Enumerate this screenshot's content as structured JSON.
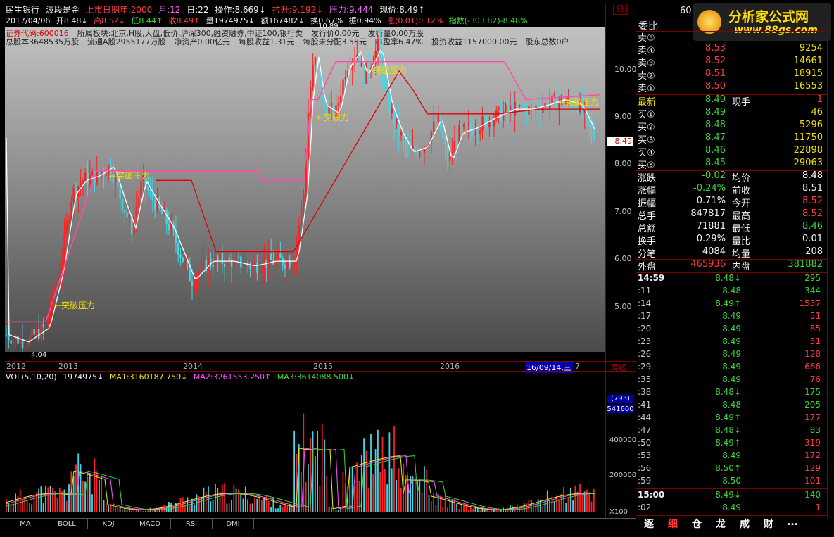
{
  "header": {
    "stock_name": "民生银行",
    "indicator": "波段是金",
    "listing_years": "上市日期年:2000",
    "month": "月:12",
    "day": "日:22",
    "operate": "操作:8.669↓",
    "pull_up": "拉升:9.192↓",
    "pressure": "压力:9.444",
    "current": "现价:8.49↑",
    "date": "2017/04/06",
    "open": "开8.48↓",
    "high": "高8.52↓",
    "low": "低8.44↑",
    "close": "收8.49↑",
    "vol": "量1974975↓",
    "amount": "额167482↓",
    "turnover": "换0.67%",
    "amplitude": "振0.94%",
    "change": "涨(0.01)0.12%",
    "index": "指数(-303.82)-8.48%"
  },
  "info": {
    "line1": [
      "证券代码:600016",
      "所属板块:北京,H股,大盘,低价,沪深300,融资融券,中证100,银行类",
      "发行价0.00元",
      "发行量0.00万股"
    ],
    "line2": [
      "总股本3648535万股",
      "流通A股2955177万股",
      "净资产0.00亿元",
      "每股收益1.31元",
      "每股未分配3.58元",
      "市盈率6.47%",
      "投资收益1157000.00元",
      "股东总数0户"
    ]
  },
  "annotations": {
    "break1": "←突破压力",
    "break2": "←突破压力",
    "break3": "←突破力",
    "break4": "←突破压力",
    "break5": "←突破压力",
    "low_label": "4.04",
    "high_label": "10.89"
  },
  "y_axis": [
    "10.00",
    "9.00",
    "8.00",
    "7.00",
    "6.00",
    "5.00"
  ],
  "price_tag": "8.49",
  "time_axis": [
    "2012",
    "2013",
    "2014",
    "2015",
    "2016"
  ],
  "time_cursor": "16/09/14,三",
  "time_cursor_tail": "7",
  "period_label": "周线",
  "top_right_box": "日",
  "vol_header": {
    "name": "VOL(5,10,20)",
    "vol": "1974975↓",
    "ma1": "MA1:3160187.750↓",
    "ma2": "MA2:3261553.250↑",
    "ma3": "MA3:3614088.500↓"
  },
  "vol_y_axis": [
    "400000",
    "200000"
  ],
  "vol_box1": "(793)",
  "vol_box2": "541600",
  "vol_unit": "X100",
  "bottom_tabs": [
    "MA",
    "BOLL",
    "KDJ",
    "MACD",
    "RSI",
    "DMI"
  ],
  "right_panel": {
    "code_partial": "60",
    "weibi": "委比",
    "sell": [
      {
        "label": "卖⑤",
        "price": "",
        "vol": ""
      },
      {
        "label": "卖④",
        "price": "8.53",
        "vol": "9254"
      },
      {
        "label": "卖③",
        "price": "8.52",
        "vol": "14661"
      },
      {
        "label": "卖②",
        "price": "8.51",
        "vol": "18915"
      },
      {
        "label": "卖①",
        "price": "8.50",
        "vol": "16553"
      }
    ],
    "latest": {
      "label": "最新",
      "price": "8.49",
      "label2": "现手",
      "value2": "1"
    },
    "buy": [
      {
        "label": "买①",
        "price": "8.49",
        "vol": "46"
      },
      {
        "label": "买②",
        "price": "8.48",
        "vol": "5296"
      },
      {
        "label": "买③",
        "price": "8.47",
        "vol": "11750"
      },
      {
        "label": "买④",
        "price": "8.46",
        "vol": "22898"
      },
      {
        "label": "买⑤",
        "price": "8.45",
        "vol": "29063"
      }
    ],
    "quotes": [
      {
        "l1": "涨跌",
        "v1": "-0.02",
        "l2": "均价",
        "v2": "8.48",
        "c1": "green",
        "c2": "wht"
      },
      {
        "l1": "涨幅",
        "v1": "-0.24%",
        "l2": "前收",
        "v2": "8.51",
        "c1": "green",
        "c2": "wht"
      },
      {
        "l1": "振幅",
        "v1": "0.71%",
        "l2": "今开",
        "v2": "8.52",
        "c1": "wht",
        "c2": "red"
      },
      {
        "l1": "总手",
        "v1": "847817",
        "l2": "最高",
        "v2": "8.52",
        "c1": "wht",
        "c2": "red"
      },
      {
        "l1": "总额",
        "v1": "71881",
        "l2": "最低",
        "v2": "8.46",
        "c1": "wht",
        "c2": "green"
      },
      {
        "l1": "换手",
        "v1": "0.29%",
        "l2": "量比",
        "v2": "0.01",
        "c1": "wht",
        "c2": "wht"
      },
      {
        "l1": "分笔",
        "v1": "4084",
        "l2": "均量",
        "v2": "208",
        "c1": "wht",
        "c2": "wht"
      },
      {
        "l1": "外盘",
        "v1": "465936",
        "l2": "内盘",
        "v2": "381882",
        "c1": "red",
        "c2": "green"
      }
    ],
    "ticks": [
      {
        "t": "14:59",
        "p": "8.48↓",
        "v": "295",
        "pc": "green",
        "vc": "green"
      },
      {
        "t": ":11",
        "p": "8.48",
        "v": "344",
        "pc": "green",
        "vc": "green"
      },
      {
        "t": ":14",
        "p": "8.49↑",
        "v": "1537",
        "pc": "green",
        "vc": "red"
      },
      {
        "t": ":17",
        "p": "8.49",
        "v": "51",
        "pc": "green",
        "vc": "red"
      },
      {
        "t": ":20",
        "p": "8.49",
        "v": "85",
        "pc": "green",
        "vc": "red"
      },
      {
        "t": ":23",
        "p": "8.49",
        "v": "31",
        "pc": "green",
        "vc": "red"
      },
      {
        "t": ":26",
        "p": "8.49",
        "v": "128",
        "pc": "green",
        "vc": "red"
      },
      {
        "t": ":29",
        "p": "8.49",
        "v": "666",
        "pc": "green",
        "vc": "red"
      },
      {
        "t": ":35",
        "p": "8.49",
        "v": "76",
        "pc": "green",
        "vc": "red"
      },
      {
        "t": ":38",
        "p": "8.48↓",
        "v": "175",
        "pc": "green",
        "vc": "green"
      },
      {
        "t": ":41",
        "p": "8.48",
        "v": "205",
        "pc": "green",
        "vc": "green"
      },
      {
        "t": ":44",
        "p": "8.49↑",
        "v": "177",
        "pc": "green",
        "vc": "red"
      },
      {
        "t": ":47",
        "p": "8.48↓",
        "v": "83",
        "pc": "green",
        "vc": "green"
      },
      {
        "t": ":50",
        "p": "8.49↑",
        "v": "319",
        "pc": "green",
        "vc": "red"
      },
      {
        "t": ":53",
        "p": "8.49",
        "v": "172",
        "pc": "green",
        "vc": "red"
      },
      {
        "t": ":56",
        "p": "8.50↑",
        "v": "129",
        "pc": "green",
        "vc": "red"
      },
      {
        "t": ":59",
        "p": "8.50",
        "v": "101",
        "pc": "green",
        "vc": "red"
      },
      {
        "t": "15:00",
        "p": "8.49↓",
        "v": "140",
        "pc": "green",
        "vc": "green"
      },
      {
        "t": ":02",
        "p": "8.49",
        "v": "1",
        "pc": "green",
        "vc": "red"
      }
    ],
    "tabs": [
      "逐",
      "细",
      "仓",
      "龙",
      "成",
      "财",
      "..."
    ]
  },
  "logo": {
    "title": "分析家公式网",
    "url": "www.88gs.com"
  },
  "colors": {
    "up": "#ff2020",
    "down": "#40d8e8",
    "pressure": "#ff4da6",
    "ma": "#ffffff",
    "accent_red": "#ff3b3b",
    "accent_green": "#3cd63c",
    "accent_yellow": "#f0e000"
  }
}
